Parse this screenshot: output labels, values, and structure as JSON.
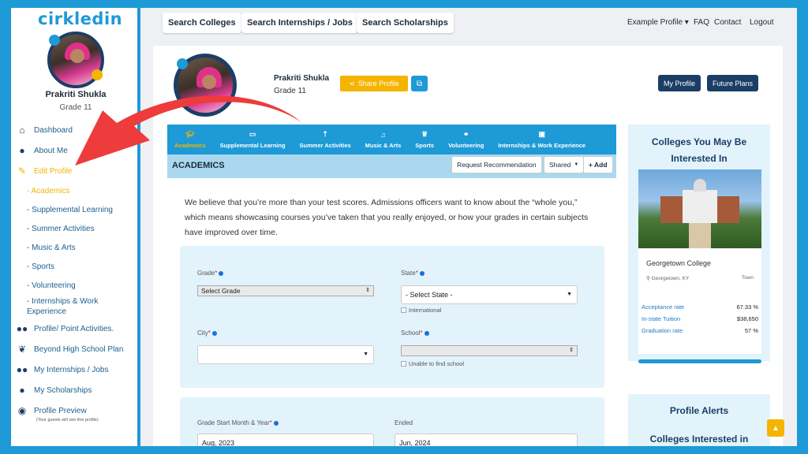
{
  "sidebar": {
    "logo": "cirkledin",
    "name": "Prakriti Shukla",
    "grade": "Grade 11",
    "items": [
      {
        "label": "Dashboard",
        "icon": "home-icon"
      },
      {
        "label": "About Me",
        "icon": "user-icon"
      },
      {
        "label": "Edit Profile",
        "icon": "edit-icon"
      }
    ],
    "sub_items": [
      "- Academics",
      "- Supplemental Learning",
      "- Summer Activities",
      "- Music & Arts",
      "- Sports",
      "- Volunteering",
      "- Internships & Work Experience"
    ],
    "items2": [
      {
        "label": "Profile/ Point Activities.",
        "icon": "users-icon"
      },
      {
        "label": "Beyond High School Plan",
        "icon": "leaf-icon"
      },
      {
        "label": "My Internships / Jobs",
        "icon": "users-icon"
      },
      {
        "label": "My Scholarships",
        "icon": "user-icon"
      },
      {
        "label": "Profile Preview",
        "icon": "eye-icon"
      }
    ],
    "preview_note": "(Your guests will see this profile)"
  },
  "topbar": {
    "search_colleges": "Search Colleges",
    "search_internships": "Search Internships / Jobs",
    "search_scholarships": "Search Scholarships",
    "example_profile": "Example Profile ▾",
    "faq": "FAQ",
    "contact": "Contact",
    "logout": "Logout"
  },
  "profile": {
    "name": "Prakriti Shukla",
    "grade": "Grade 11",
    "share_label": "Share Profile",
    "my_profile": "My Profile",
    "future_plans": "Future Plans"
  },
  "tabs": [
    {
      "label": "Academics",
      "icon": "graduation-cap-icon"
    },
    {
      "label": "Supplemental Learning",
      "icon": "book-icon"
    },
    {
      "label": "Summer Activities",
      "icon": "torch-icon"
    },
    {
      "label": "Music & Arts",
      "icon": "music-icon"
    },
    {
      "label": "Sports",
      "icon": "trophy-icon"
    },
    {
      "label": "Volunteering",
      "icon": "handshake-icon"
    },
    {
      "label": "Internships & Work Experience",
      "icon": "briefcase-icon"
    }
  ],
  "academics": {
    "title": "ACADEMICS",
    "request_recommendation": "Request Recommendation",
    "shared": "Shared",
    "add": "+ Add",
    "intro": "We believe that you’re more than your test scores. Admissions officers want to know about the “whole you,” which means showcasing courses you’ve taken that you really enjoyed, or how your grades in certain subjects have improved over time."
  },
  "form": {
    "grade_label": "Grade",
    "grade_value": "Select Grade",
    "state_label": "State",
    "state_value": "- Select State -",
    "international": "International",
    "city_label": "City",
    "city_value": "",
    "school_label": "School",
    "school_value": "",
    "unable_school": "Unable to find school",
    "start_label": "Grade Start Month & Year",
    "start_value": "Aug, 2023",
    "ended_label": "Ended",
    "ended_value": "Jun, 2024"
  },
  "college_card": {
    "title": "Colleges You May Be Interested In",
    "name": "Georgetown College",
    "location": "Georgetown, KY",
    "type": "Town",
    "rows": [
      {
        "k": "Acceptance rate",
        "v": "67.33 %"
      },
      {
        "k": "In-state Tuition",
        "v": "$38,650"
      },
      {
        "k": "Graduation rate",
        "v": "57 %"
      }
    ]
  },
  "alerts": {
    "title": "Profile Alerts",
    "sub": "Colleges Interested in"
  },
  "colors": {
    "brand_blue": "#1e9ad6",
    "navy": "#1c3e66",
    "accent_yellow": "#f4b400",
    "arrow_red": "#ee3b3b"
  }
}
